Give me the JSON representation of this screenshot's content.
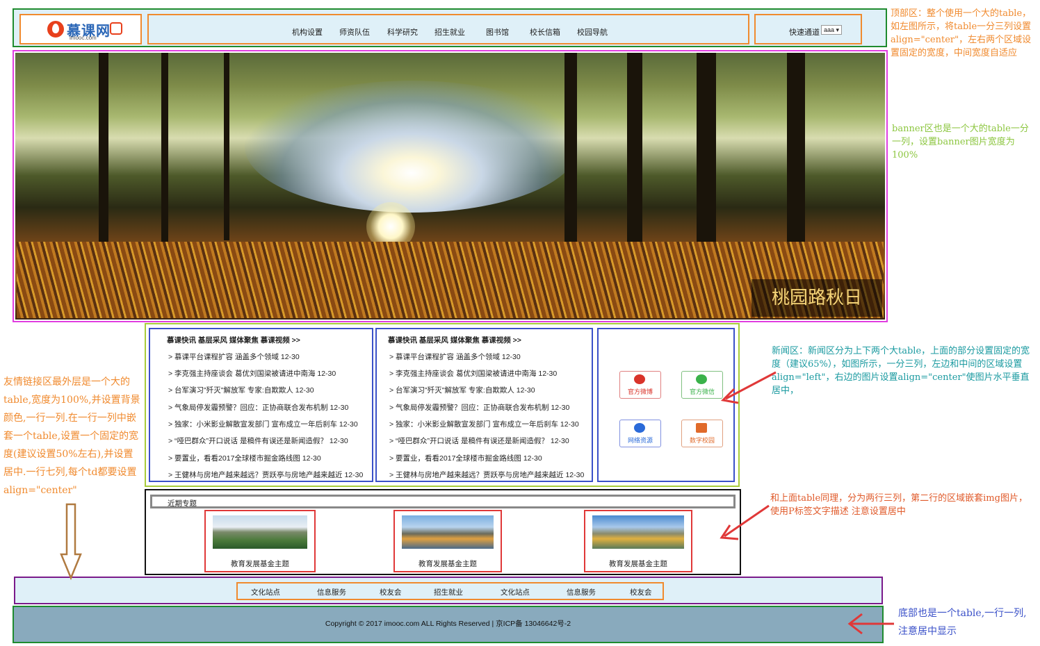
{
  "header": {
    "logo_text": "慕课网",
    "logo_sub": "imooc.com",
    "nav": [
      "机构设置",
      "师资队伍",
      "科学研究",
      "招生就业",
      "图书馆",
      "校长信箱",
      "校园导航"
    ],
    "quick_label": "快速通道",
    "quick_select": "aaa"
  },
  "banner": {
    "caption": "桃园路秋日"
  },
  "news": {
    "title": "慕课快讯 基层采风 媒体聚焦 慕课视频 >>",
    "items": [
      "> 慕课平台课程扩容 涵盖多个领域 12-30",
      "> 李克强主持座谈会 葛优刘国梁被请进中南海 12-30",
      "> 台军演习\"歼灭\"解放军 专家:自欺欺人 12-30",
      "> 气象局停发霾预警？回应：正协商联合发布机制 12-30",
      "> 独家：小米影业解散宣发部门 宣布成立一年后刹车 12-30",
      "> “哑巴群众”开口说话 是稿件有误还是新闻造假？ 12-30",
      "> 要置业，看看2017全球楼市掘金路线图 12-30",
      "> 王健林与房地产越来越远？贾跃亭与房地产越来越近 12-30"
    ],
    "badges": [
      {
        "label": "官方微博",
        "color": "#d9332a",
        "icon": "weibo-icon"
      },
      {
        "label": "官方微信",
        "color": "#3ab24a",
        "icon": "wechat-icon"
      },
      {
        "label": "网络资源",
        "color": "#2a6ad9",
        "icon": "ie-icon"
      },
      {
        "label": "数字校园",
        "color": "#e06a2a",
        "icon": "computer-icon"
      }
    ]
  },
  "topics": {
    "title": "近期专题",
    "cards": [
      "教育发展基金主题",
      "教育发展基金主题",
      "教育发展基金主题"
    ]
  },
  "links": [
    "文化站点",
    "信息服务",
    "校友会",
    "招生就业",
    "文化站点",
    "信息服务",
    "校友会"
  ],
  "footer": {
    "copyright": "Copyright © 2017 imooc.com ALL Rights Reserved | 京ICP备 13046642号-2"
  },
  "annotations": {
    "top": "顶部区：整个使用一个大的table，如左图所示，将table一分三列设置align=\"center\"，左右两个区域设置固定的宽度，中间宽度自适应",
    "banner": "banner区也是一个大的table一分一列，设置banner图片宽度为100%",
    "news": "新闻区：新闻区分为上下两个大table，上面的部分设置固定的宽度（建议65%），如图所示，一分三列，左边和中间的区域设置align=\"left\"，右边的图片设置align=\"center\"使图片水平垂直居中，",
    "topics": "和上面table同理，分为两行三列，第二行的区域嵌套img图片，使用P标签文字描述 注意设置居中",
    "links": "友情链接区最外层是一个大的table,宽度为100%,并设置背景颜色,一行一列.在一行一列中嵌套一个table,设置一个固定的宽度(建议设置50%左右),并设置居中.一行七列,每个td都要设置align=\"center\"",
    "footer": "底部也是一个table,一行一列,注意居中显示"
  },
  "colors": {
    "header_border": "#1e8b2e",
    "cell_border": "#f08a2e",
    "banner_border": "#e03ee0",
    "news_border": "#a8cc3a",
    "news_col_border": "#3a50c8",
    "topics_border": "#111111",
    "card_border": "#e03838",
    "links_border": "#7a1a8a",
    "footer_bg": "#89aabd",
    "light_bg": "#dff0f8"
  }
}
